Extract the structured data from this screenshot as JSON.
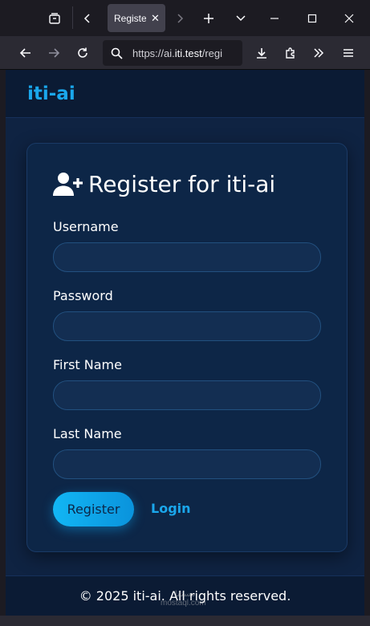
{
  "browser": {
    "tab": {
      "label": "Registe",
      "close_glyph": "✕"
    },
    "url": {
      "prefix": "https://ai.",
      "host": "iti.test",
      "suffix": "/regi"
    },
    "icons": [
      "tab-overview-icon",
      "back-tabs-icon",
      "forward-tabs-icon",
      "new-tab-icon",
      "list-tabs-icon",
      "minimize-icon",
      "maximize-icon",
      "close-window-icon",
      "back-icon",
      "forward-icon",
      "reload-icon",
      "search-icon",
      "download-icon",
      "extensions-icon",
      "more-tools-icon",
      "menu-icon"
    ]
  },
  "site": {
    "brand": "iti-ai",
    "card": {
      "title": "Register for iti-ai",
      "fields": [
        {
          "label": "Username",
          "value": ""
        },
        {
          "label": "Password",
          "value": ""
        },
        {
          "label": "First Name",
          "value": ""
        },
        {
          "label": "Last Name",
          "value": ""
        }
      ],
      "register_label": "Register",
      "login_label": "Login"
    },
    "footer": "© 2025 iti-ai. All rights reserved."
  },
  "watermark": {
    "line1": "مستقل",
    "line2": "mostaql.com"
  },
  "colors": {
    "accent": "#1aa7ec",
    "page_bg": "#0f2342",
    "card_bg": "#0d2647",
    "header_bg": "#0b1b34"
  }
}
